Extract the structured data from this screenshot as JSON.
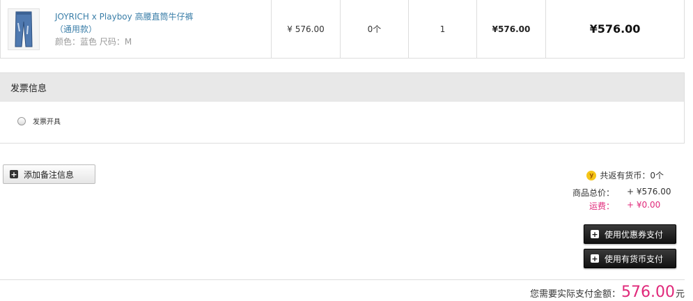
{
  "product": {
    "name_line1": "JOYRICH x Playboy 高腰直筒牛仔裤",
    "name_line2": "（通用款）",
    "attrs": "颜色：蓝色  尺码：M",
    "unit_price": "¥ 576.00",
    "coins": "0个",
    "quantity": "1",
    "subtotal": "¥576.00",
    "total": "¥576.00"
  },
  "invoice": {
    "title": "发票信息",
    "option_label": "发票开具"
  },
  "remark_button": "添加备注信息",
  "summary": {
    "coin_icon": "y",
    "coin_text": "共返有货币：0个",
    "goods_label": "商品总价：",
    "goods_value": "+ ¥576.00",
    "shipping_label": "运费：",
    "shipping_value": "+ ¥0.00"
  },
  "buttons": {
    "coupon": "使用优惠券支付",
    "coin_pay": "使用有货币支付"
  },
  "payment": {
    "label": "您需要实际支付金额：",
    "amount": "576.00",
    "unit": "元"
  },
  "colors": {
    "accent": "#e0287a",
    "link": "#3a7ea8",
    "header_bg": "#e8e8e8"
  }
}
